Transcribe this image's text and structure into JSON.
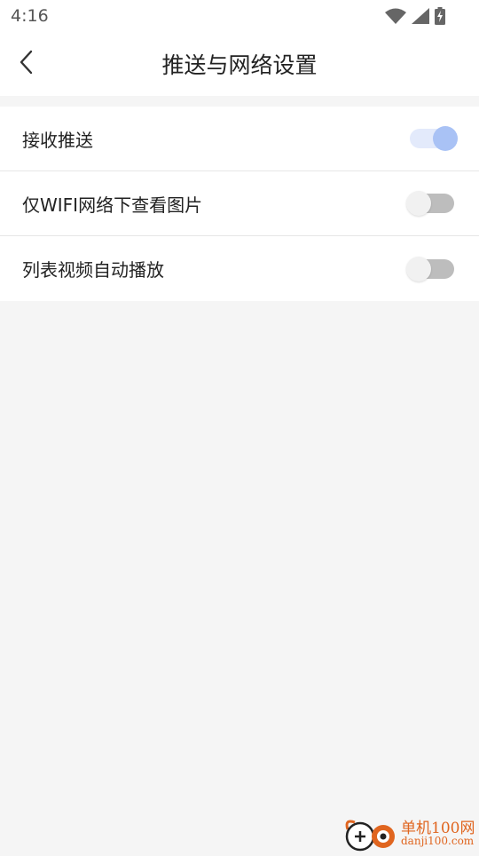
{
  "status_bar": {
    "time": "4:16",
    "icons": [
      "wifi-icon",
      "cellular-signal-icon",
      "battery-charging-icon"
    ]
  },
  "header": {
    "back_icon": "chevron-left-icon",
    "title": "推送与网络设置"
  },
  "settings": [
    {
      "label": "接收推送",
      "enabled": true
    },
    {
      "label": "仅WIFI网络下查看图片",
      "enabled": false
    },
    {
      "label": "列表视频自动播放",
      "enabled": false
    }
  ],
  "watermark": {
    "brand": "单机100网",
    "site": "danji100.com"
  },
  "colors": {
    "toggle_on_track": "#e3eafb",
    "toggle_on_knob": "#a9c2f5",
    "toggle_off_track": "#bdbdbd",
    "toggle_off_knob": "#f1f1f1",
    "watermark": "#e0651f"
  }
}
